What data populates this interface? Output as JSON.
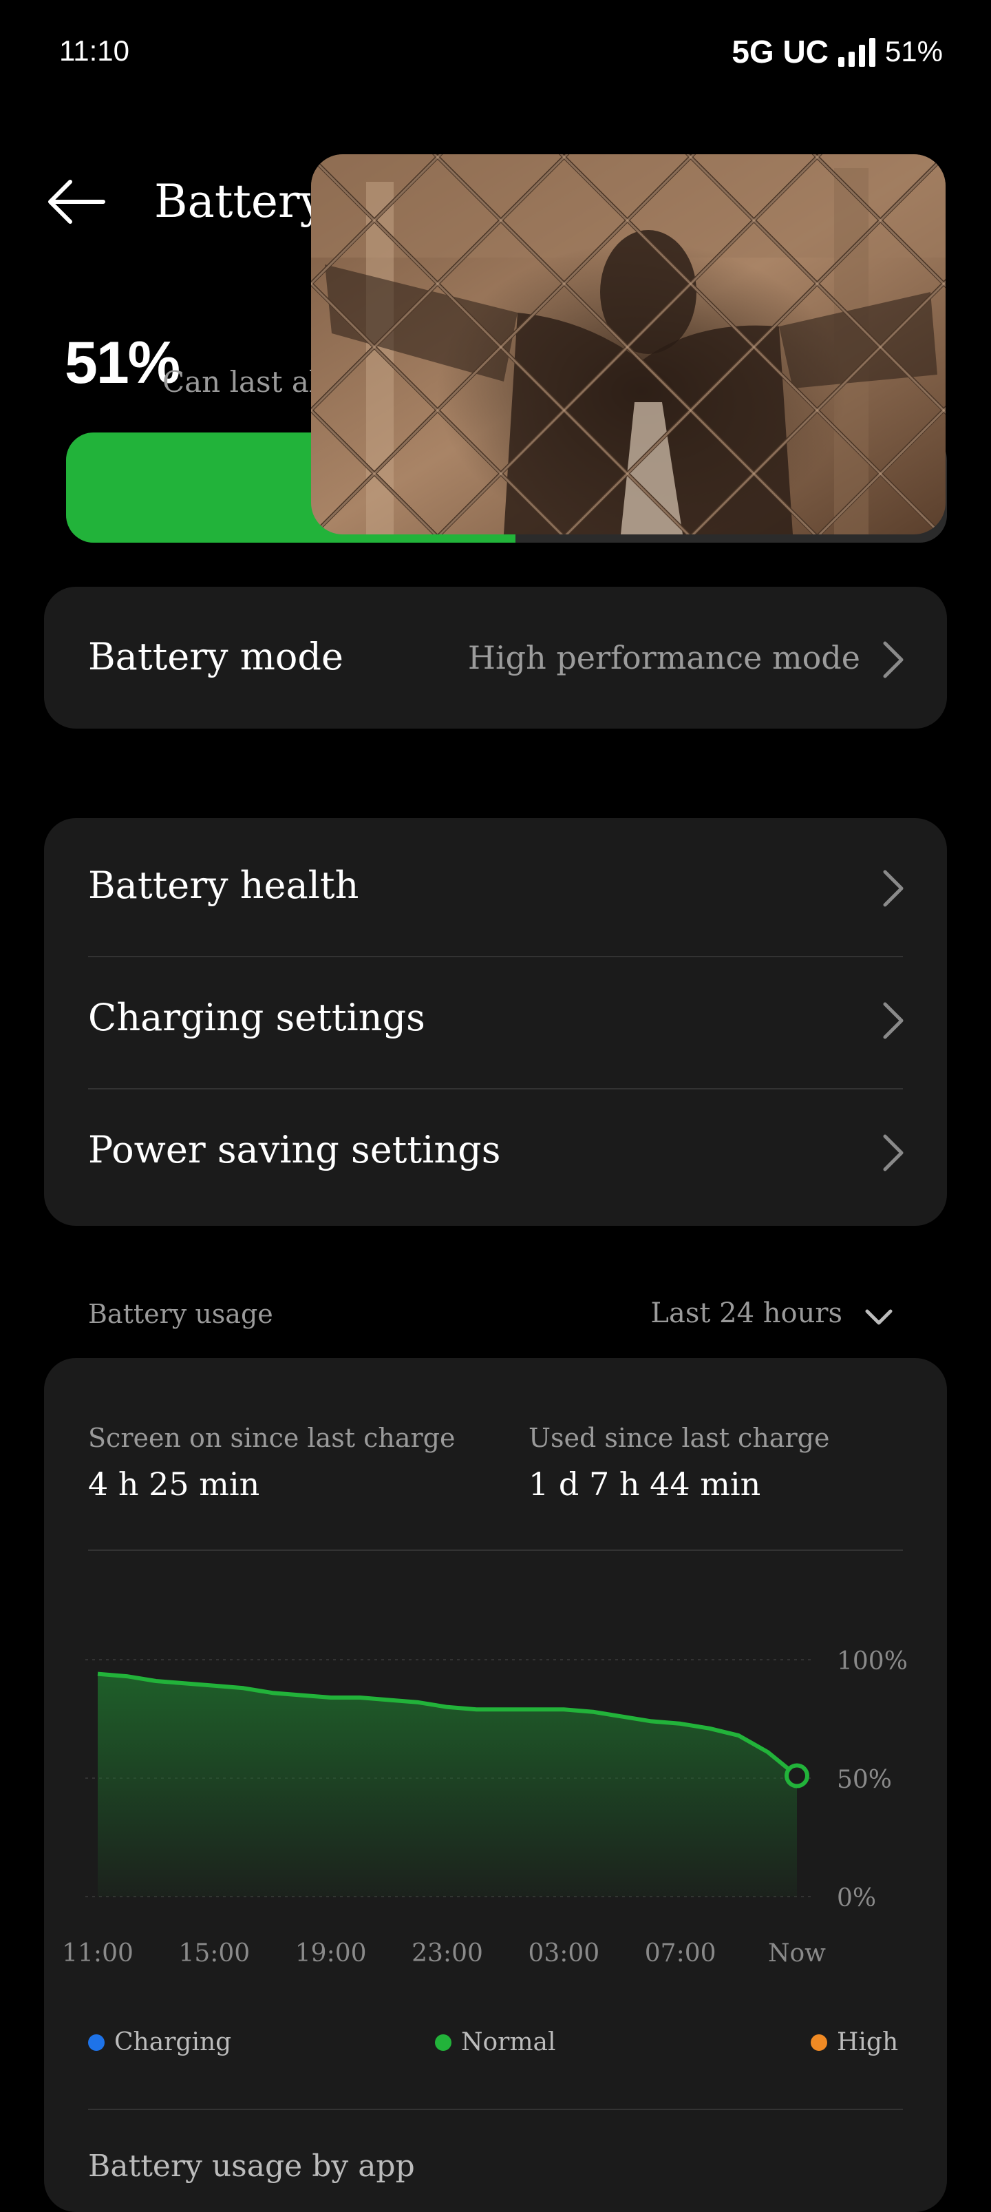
{
  "status_bar": {
    "time": "11:10",
    "network": "5G UC",
    "battery": "51%"
  },
  "header": {
    "back_icon": "arrow-left-icon",
    "title": "Battery"
  },
  "battery_summary": {
    "percent_label": "51%",
    "estimate": "Can last abo",
    "level": 0.51,
    "fill_color": "#22b33a"
  },
  "pip_video": {
    "description_icon": "video-pip-icon"
  },
  "battery_mode": {
    "label": "Battery mode",
    "value": "High performance mode"
  },
  "settings_list": {
    "items": [
      {
        "label": "Battery health"
      },
      {
        "label": "Charging settings"
      },
      {
        "label": "Power saving settings"
      }
    ]
  },
  "usage": {
    "section_label": "Battery usage",
    "range": "Last 24 hours",
    "screen_on_label": "Screen on since last charge",
    "screen_on_value": "4 h 25 min",
    "used_label": "Used since last charge",
    "used_value": "1 d 7 h 44 min",
    "legend": [
      {
        "label": "Charging",
        "color": "#1e73e8"
      },
      {
        "label": "Normal",
        "color": "#22b33a"
      },
      {
        "label": "High",
        "color": "#f08a24"
      }
    ]
  },
  "chart_data": {
    "type": "area",
    "x_tick_labels": [
      "11:00",
      "15:00",
      "19:00",
      "23:00",
      "03:00",
      "07:00",
      "Now"
    ],
    "y_tick_labels": [
      "100%",
      "50%",
      "0%"
    ],
    "ylim": [
      0,
      100
    ],
    "x": [
      0,
      1,
      2,
      3,
      4,
      5,
      6,
      7,
      8,
      9,
      10,
      11,
      12,
      13,
      14,
      15,
      16,
      17,
      18,
      19,
      20,
      21,
      22,
      23,
      24
    ],
    "values": [
      94,
      93,
      91,
      90,
      89,
      88,
      86,
      85,
      84,
      84,
      83,
      82,
      80,
      79,
      79,
      79,
      79,
      78,
      76,
      74,
      73,
      71,
      68,
      61,
      51
    ],
    "series": [
      {
        "name": "Normal",
        "color": "#22b33a"
      }
    ],
    "grid": true
  },
  "app_usage": {
    "title": "Battery usage by app"
  }
}
